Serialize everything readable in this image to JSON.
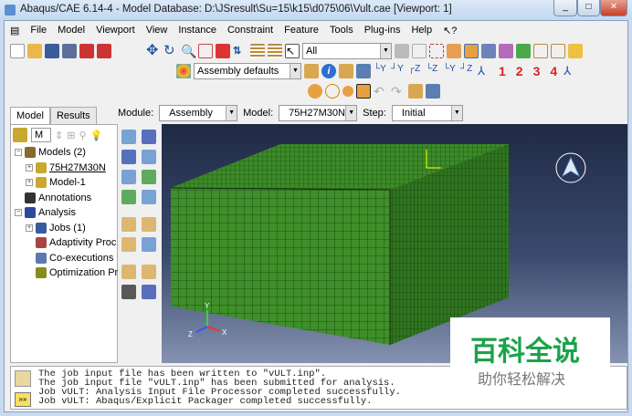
{
  "title": "Abaqus/CAE 6.14-4 - Model Database: D:\\JSresult\\Su=15\\k15\\d075\\06\\Vult.cae [Viewport: 1]",
  "menu": [
    "File",
    "Model",
    "Viewport",
    "View",
    "Instance",
    "Constraint",
    "Feature",
    "Tools",
    "Plug-ins",
    "Help",
    "↖?"
  ],
  "toolbar": {
    "selection_filter": "All",
    "render_style": "Assembly defaults",
    "view_numbers": [
      "1",
      "2",
      "3",
      "4"
    ]
  },
  "context": {
    "module_label": "Module:",
    "module": "Assembly",
    "model_label": "Model:",
    "model": "75H27M30N",
    "step_label": "Step:",
    "step": "Initial"
  },
  "tabs": [
    "Model",
    "Results"
  ],
  "tree_combo": "M",
  "tree": [
    {
      "label": "Models (2)",
      "level": 0,
      "exp": "−"
    },
    {
      "label": "75H27M30N",
      "level": 1,
      "exp": "+"
    },
    {
      "label": "Model-1",
      "level": 1,
      "exp": "+"
    },
    {
      "label": "Annotations",
      "level": 0,
      "exp": ""
    },
    {
      "label": "Analysis",
      "level": 0,
      "exp": "−"
    },
    {
      "label": "Jobs (1)",
      "level": 1,
      "exp": "+"
    },
    {
      "label": "Adaptivity Proc",
      "level": 1,
      "exp": ""
    },
    {
      "label": "Co-executions",
      "level": 1,
      "exp": ""
    },
    {
      "label": "Optimization Pr",
      "level": 1,
      "exp": ""
    }
  ],
  "triad": {
    "x": "X",
    "y": "Y",
    "z": "Z"
  },
  "messages": [
    "The job input file has been written to \"vULT.inp\".",
    "The job input file \"vULT.inp\" has been submitted for analysis.",
    "Job vULT: Analysis Input File Processor completed successfully.",
    "Job vULT: Abaqus/Explicit Packager completed successfully."
  ],
  "watermark": {
    "title": "百科全说",
    "subtitle": "助你轻松解决"
  },
  "colors": {
    "mesh": "#3f8f2a",
    "viewport_top": "#202a44",
    "viewport_bottom": "#8592b0",
    "watermark_green": "#1aa34a"
  }
}
